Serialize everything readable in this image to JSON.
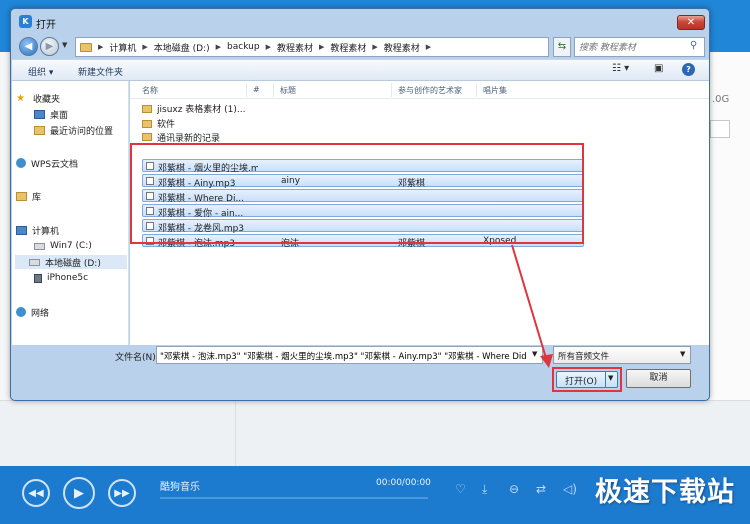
{
  "player": {
    "song_title": "酷狗音乐",
    "time": "00:00/00:00",
    "prev_icon": "prev-icon",
    "play_icon": "play-icon",
    "next_icon": "next-icon"
  },
  "background": {
    "size_label": ".0G"
  },
  "watermark": "极速下载站",
  "dialog": {
    "title": "打开",
    "close_label": "✕",
    "address": {
      "crumbs": [
        "计算机",
        "本地磁盘 (D:)",
        "backup",
        "教程素材",
        "教程素材",
        "教程素材"
      ],
      "search_placeholder": "搜索 教程素材"
    },
    "toolbar": {
      "organize": "组织 ▾",
      "new_folder": "新建文件夹"
    },
    "nav": {
      "favorites": "收藏夹",
      "desktop": "桌面",
      "recent": "最近访问的位置",
      "wps": "WPS云文档",
      "libraries": "库",
      "computer": "计算机",
      "drive_c": "Win7 (C:)",
      "drive_d": "本地磁盘 (D:)",
      "phone": "iPhone5c",
      "network": "网络"
    },
    "columns": [
      "名称",
      "#",
      "标题",
      "参与创作的艺术家",
      "唱片集"
    ],
    "folders": [
      "jisuxz 表格素材 (1)...",
      "软件",
      "通讯录新的记录"
    ],
    "files": [
      {
        "name": "邓紫棋 - 烟火里的尘埃.mp3",
        "title": "",
        "artist": "",
        "album": ""
      },
      {
        "name": "邓紫棋 - Ainy.mp3",
        "title": "ainy",
        "artist": "邓紫棋",
        "album": ""
      },
      {
        "name": "邓紫棋 - Where Di...",
        "title": "",
        "artist": "",
        "album": ""
      },
      {
        "name": "邓紫棋 - 爱你 - ain...",
        "title": "",
        "artist": "",
        "album": ""
      },
      {
        "name": "邓紫棋 - 龙卷风.mp3",
        "title": "",
        "artist": "",
        "album": ""
      },
      {
        "name": "邓紫棋 - 泡沫.mp3",
        "title": "泡沫",
        "artist": "邓紫棋",
        "album": "Xposed"
      }
    ],
    "filename_label": "文件名(N):",
    "filename_value": "\"邓紫棋 - 泡沫.mp3\" \"邓紫棋 - 烟火里的尘埃.mp3\" \"邓紫棋 - Ainy.mp3\" \"邓紫棋 - Where Did You G",
    "filetype": "所有音频文件",
    "open_label": "打开(O)",
    "cancel_label": "取消"
  },
  "colors": {
    "accent": "#1c7bcf",
    "highlight": "#e0353b",
    "selection": "#c9e0fa"
  }
}
